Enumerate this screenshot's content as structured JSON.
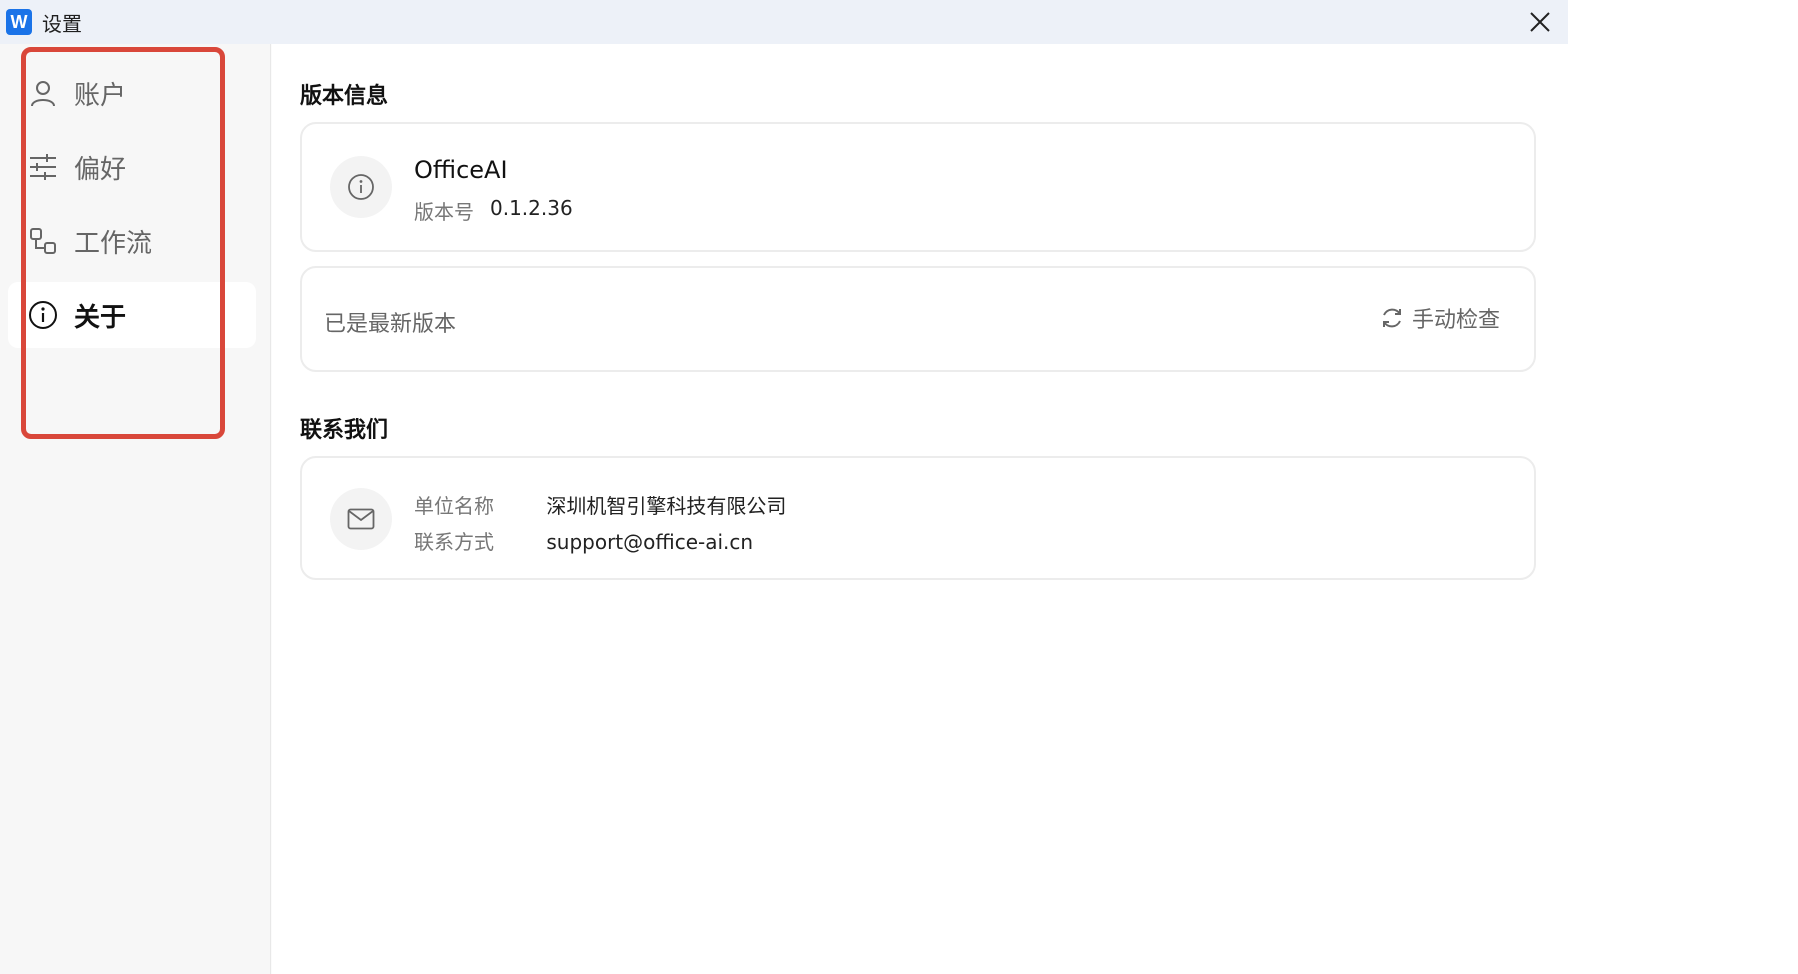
{
  "window": {
    "title": "设置",
    "app_logo_letter": "W",
    "accent_color": "#1a73e8"
  },
  "sidebar": {
    "items": [
      {
        "label": "账户",
        "icon": "user-icon"
      },
      {
        "label": "偏好",
        "icon": "sliders-icon"
      },
      {
        "label": "工作流",
        "icon": "workflow-icon"
      },
      {
        "label": "关于",
        "icon": "info-icon",
        "active": true
      }
    ],
    "highlight_color": "#d9473a"
  },
  "main": {
    "version_section": {
      "title": "版本信息",
      "product_name": "OfficeAI",
      "version_label": "版本号",
      "version_value": "0.1.2.36"
    },
    "update_card": {
      "status": "已是最新版本",
      "check_button_label": "手动检查"
    },
    "contact_section": {
      "title": "联系我们",
      "org_label": "单位名称",
      "org_value": "深圳机智引擎科技有限公司",
      "contact_label": "联系方式",
      "contact_value": "support@office-ai.cn"
    }
  }
}
